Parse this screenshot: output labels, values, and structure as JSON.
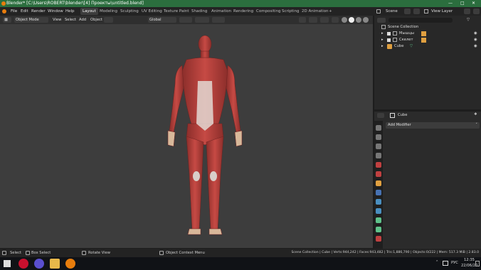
{
  "window": {
    "title": "Blender* [C:\\Users\\ROBERT\\blender\\[4] Проекты\\untitled.blend]"
  },
  "menu": [
    "File",
    "Edit",
    "Render",
    "Window",
    "Help"
  ],
  "workspaces": [
    "Layout",
    "Modeling",
    "Sculpting",
    "UV Editing",
    "Texture Paint",
    "Shading",
    "Animation",
    "Rendering",
    "Compositing",
    "Scripting",
    "2D Animation"
  ],
  "active_workspace": "Layout",
  "scene": {
    "label": "Scene",
    "view_layer": "View Layer"
  },
  "viewport_header": {
    "mode": "Object Mode",
    "menus": [
      "View",
      "Select",
      "Add",
      "Object"
    ],
    "orientation": "Global"
  },
  "outliner": {
    "collection": "Scene Collection",
    "items": [
      {
        "name": "Мышцы"
      },
      {
        "name": "Скелет"
      },
      {
        "name": "Cube"
      }
    ]
  },
  "properties": {
    "object": "Cube",
    "add_modifier": "Add Modifier"
  },
  "status": {
    "select": "Select",
    "box_select": "Box Select",
    "rotate": "Rotate View",
    "context": "Object Context Menu",
    "stats": "Scene Collection | Cube | Verts:944,242 | Faces:943,482 | Tris:1,886,790 | Objects:0/222 | Mem: 517.3 MiB | 2.83.0"
  },
  "taskbar": {
    "lang": "РУС",
    "time": "12:35",
    "date": "22/06/20"
  },
  "colors": {
    "titlebar": "#2b6e3e",
    "viewport": "#3d3d3d",
    "muscle": "#b3403c",
    "accent": "#4772b3"
  }
}
